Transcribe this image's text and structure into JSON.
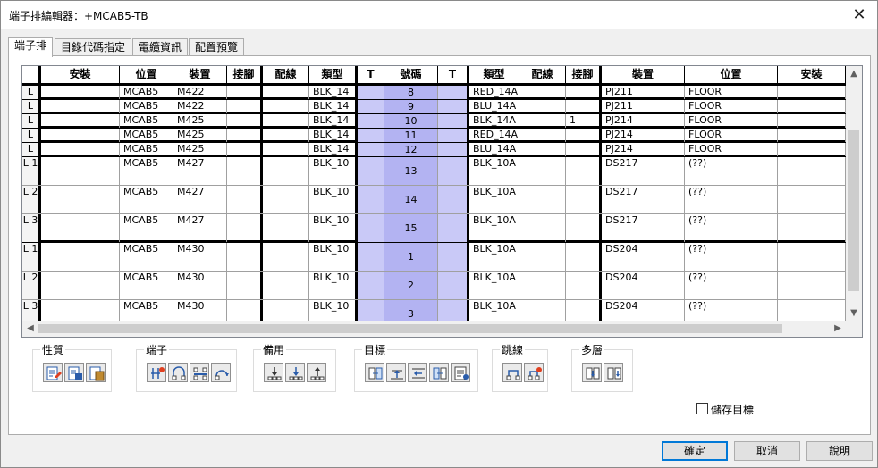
{
  "window": {
    "title": "端子排編輯器：+MCAB5-TB",
    "close_glyph": "✕"
  },
  "tabs": [
    {
      "label": "端子排",
      "active": true
    },
    {
      "label": "目錄代碼指定",
      "active": false
    },
    {
      "label": "電纜資訊",
      "active": false
    },
    {
      "label": "配置預覽",
      "active": false
    }
  ],
  "grid": {
    "headers": [
      "",
      "安裝",
      "位置",
      "裝置",
      "接腳",
      "配線",
      "類型",
      "T",
      "號碼",
      "T",
      "類型",
      "配線",
      "接腳",
      "裝置",
      "位置",
      "安裝"
    ],
    "rows": [
      {
        "rl": "L",
        "loc": "MCAB5",
        "dev": "M422",
        "type": "BLK_14",
        "num": "8",
        "rtype": "RED_14A",
        "rpin": "",
        "rdev": "PJ211",
        "rloc": "FLOOR"
      },
      {
        "rl": "L",
        "loc": "MCAB5",
        "dev": "M422",
        "type": "BLK_14",
        "num": "9",
        "rtype": "BLU_14A",
        "rpin": "",
        "rdev": "PJ211",
        "rloc": "FLOOR"
      },
      {
        "rl": "L",
        "loc": "MCAB5",
        "dev": "M425",
        "type": "BLK_14",
        "num": "10",
        "rtype": "BLK_14A",
        "rpin": "1",
        "rdev": "PJ214",
        "rloc": "FLOOR"
      },
      {
        "rl": "L",
        "loc": "MCAB5",
        "dev": "M425",
        "type": "BLK_14",
        "num": "11",
        "rtype": "RED_14A",
        "rpin": "",
        "rdev": "PJ214",
        "rloc": "FLOOR"
      },
      {
        "rl": "L",
        "loc": "MCAB5",
        "dev": "M425",
        "type": "BLK_14",
        "num": "12",
        "rtype": "BLU_14A",
        "rpin": "",
        "rdev": "PJ214",
        "rloc": "FLOOR"
      },
      {
        "rl": "L 1",
        "loc": "MCAB5",
        "dev": "M427",
        "type": "BLK_10",
        "num": "13",
        "rtype": "BLK_10A",
        "rpin": "",
        "rdev": "DS217",
        "rloc": "(??)"
      },
      {
        "rl": "L 2",
        "loc": "MCAB5",
        "dev": "M427",
        "type": "BLK_10",
        "num": "14",
        "rtype": "BLK_10A",
        "rpin": "",
        "rdev": "DS217",
        "rloc": "(??)"
      },
      {
        "rl": "L 3",
        "loc": "MCAB5",
        "dev": "M427",
        "type": "BLK_10",
        "num": "15",
        "rtype": "BLK_10A",
        "rpin": "",
        "rdev": "DS217",
        "rloc": "(??)"
      },
      {
        "rl": "L 1",
        "loc": "MCAB5",
        "dev": "M430",
        "type": "BLK_10",
        "num": "1",
        "rtype": "BLK_10A",
        "rpin": "",
        "rdev": "DS204",
        "rloc": "(??)"
      },
      {
        "rl": "L 2",
        "loc": "MCAB5",
        "dev": "M430",
        "type": "BLK_10",
        "num": "2",
        "rtype": "BLK_10A",
        "rpin": "",
        "rdev": "DS204",
        "rloc": "(??)"
      },
      {
        "rl": "L 3",
        "loc": "MCAB5",
        "dev": "M430",
        "type": "BLK_10",
        "num": "3",
        "rtype": "BLK_10A",
        "rpin": "",
        "rdev": "DS204",
        "rloc": "(??)"
      }
    ]
  },
  "toolbar": {
    "groups": [
      {
        "label": "性質",
        "icons": [
          "edit-properties-icon",
          "catalog-properties-icon",
          "paste-properties-icon"
        ]
      },
      {
        "label": "端子",
        "icons": [
          "move-terminal-icon",
          "jumper-terminal-icon",
          "split-terminal-icon",
          "reverse-terminal-icon"
        ]
      },
      {
        "label": "備用",
        "icons": [
          "insert-spare-below-icon",
          "insert-spare-icon",
          "insert-spare-above-icon"
        ]
      },
      {
        "label": "目標",
        "icons": [
          "target-left-icon",
          "target-up-icon",
          "target-swap-icon",
          "target-right-icon",
          "target-list-icon"
        ]
      },
      {
        "label": "跳線",
        "icons": [
          "jumper-icon",
          "edit-jumper-icon"
        ]
      },
      {
        "label": "多層",
        "icons": [
          "multilevel-left-icon",
          "multilevel-right-icon"
        ]
      }
    ]
  },
  "save_target": {
    "label": "儲存目標",
    "checked": false
  },
  "buttons": {
    "ok": "確定",
    "cancel": "取消",
    "help": "說明"
  },
  "colors": {
    "t_column": "#c9c9f7",
    "number_column": "#b3b3f2",
    "primary_border": "#0078d7"
  }
}
